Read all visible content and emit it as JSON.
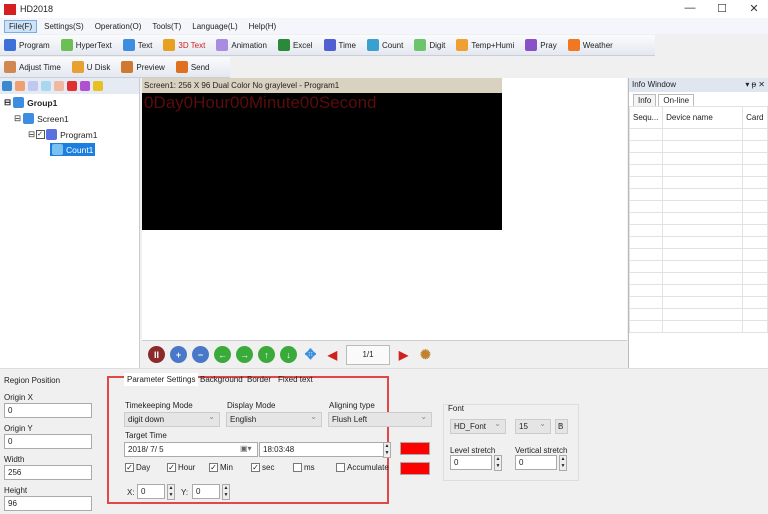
{
  "window": {
    "title": "HD2018",
    "minimize": "—",
    "maximize": "☐",
    "close": "✕"
  },
  "menu": [
    "File(F)",
    "Settings(S)",
    "Operation(O)",
    "Tools(T)",
    "Language(L)",
    "Help(H)"
  ],
  "toolbar1": [
    {
      "label": "Program",
      "color": "#3d6fd8"
    },
    {
      "label": "HyperText",
      "color": "#6cbf55"
    },
    {
      "label": "Text",
      "color": "#3d8de0"
    },
    {
      "label": "3D Text",
      "color": "#e8a020",
      "label_color": "#d02020"
    },
    {
      "label": "Animation",
      "color": "#a88ce0"
    },
    {
      "label": "Excel",
      "color": "#2a8a3a"
    },
    {
      "label": "Time",
      "color": "#5060d0"
    },
    {
      "label": "Count",
      "color": "#3aa0d0"
    },
    {
      "label": "Digit",
      "color": "#6cc46c"
    },
    {
      "label": "Temp+Humi",
      "color": "#f0a030"
    },
    {
      "label": "Pray",
      "color": "#8a50c8"
    },
    {
      "label": "Weather",
      "color": "#f07820"
    }
  ],
  "toolbar2": [
    {
      "label": "Adjust Time",
      "color": "#d08850"
    },
    {
      "label": "U Disk",
      "color": "#e8a030"
    },
    {
      "label": "Preview",
      "color": "#d07830"
    },
    {
      "label": "Send",
      "color": "#e07020"
    }
  ],
  "tree": {
    "group": "Group1",
    "screen": "Screen1",
    "program": "Program1",
    "count": "Count1"
  },
  "screen_header": "Screen1: 256 X 96  Dual Color No graylevel - Program1",
  "led_text": "0Day0Hour00Minute00Second",
  "nav": {
    "page": "1/1"
  },
  "info_window": {
    "title": "Info Window",
    "tabs": [
      "Info",
      "On-line"
    ],
    "columns": [
      "Sequ...",
      "Device name",
      "Card"
    ]
  },
  "region": {
    "title": "Region Position",
    "origin_x_label": "Origin X",
    "origin_x": "0",
    "origin_y_label": "Origin Y",
    "origin_y": "0",
    "width_label": "Width",
    "width": "256",
    "height_label": "Height",
    "height": "96"
  },
  "params": {
    "tabs": [
      "Parameter Settings",
      "Background",
      "Border",
      "Fixed text"
    ],
    "timekeeping_label": "Timekeeping Mode",
    "timekeeping": "digit down",
    "display_label": "Display Mode",
    "display": "English",
    "align_label": "Aligning type",
    "align": "Flush Left",
    "target_label": "Target Time",
    "target_date": "2018/ 7/ 5",
    "target_time": "18:03:48",
    "checks": [
      {
        "label": "Day",
        "checked": true
      },
      {
        "label": "Hour",
        "checked": true
      },
      {
        "label": "Min",
        "checked": true
      },
      {
        "label": "sec",
        "checked": true
      },
      {
        "label": "ms",
        "checked": false
      },
      {
        "label": "Accumulate",
        "checked": false
      }
    ],
    "x_label": "X:",
    "x": "0",
    "y_label": "Y:",
    "y": "0",
    "color1": "#ff0000",
    "color2": "#ff0000"
  },
  "font": {
    "title": "Font",
    "name": "HD_Font",
    "size": "15",
    "bold": "B",
    "level_label": "Level stretch",
    "level": "0",
    "vertical_label": "Vertical stretch",
    "vertical": "0"
  }
}
